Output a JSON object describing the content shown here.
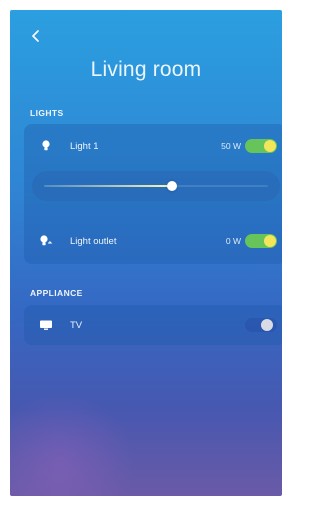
{
  "header": {
    "back_icon": "chevron-left-icon",
    "title": "Living room"
  },
  "lights": {
    "section_label": "LIGHTS",
    "items": [
      {
        "label": "Light 1",
        "watt": "50 W",
        "icon": "bulb-icon",
        "on": true
      },
      {
        "label": "Light outlet",
        "watt": "0 W",
        "icon": "outlet-bulb-icon",
        "on": true
      }
    ],
    "dimmer_level": 0.57
  },
  "appliance": {
    "section_label": "APPLIANCE",
    "items": [
      {
        "label": "TV",
        "icon": "tv-icon",
        "on": false
      }
    ]
  },
  "colors": {
    "toggle_on_track": "#67c45a",
    "toggle_on_knob": "#f4e65a",
    "toggle_off_knob": "#d9dbe4"
  }
}
